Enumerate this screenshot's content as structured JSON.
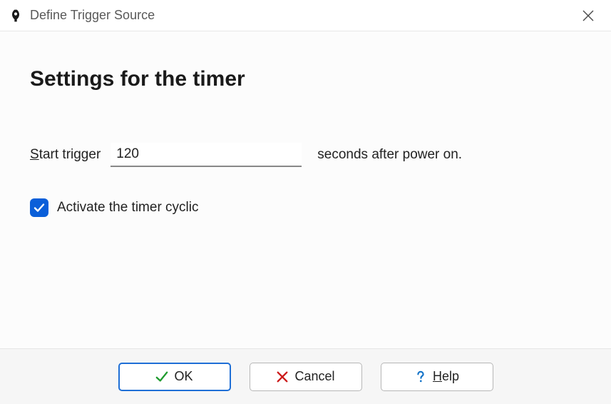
{
  "titlebar": {
    "title": "Define Trigger Source"
  },
  "content": {
    "heading": "Settings for the timer",
    "start_label_underline_letter": "S",
    "start_label_rest": "tart trigger",
    "seconds_value": "120",
    "after_label": "seconds after power on.",
    "checkbox_checked": true,
    "checkbox_label": "Activate the timer cyclic"
  },
  "footer": {
    "ok_label": "OK",
    "cancel_label": "Cancel",
    "help_underline_letter": "H",
    "help_rest": "elp"
  },
  "colors": {
    "accent": "#0a5fd9",
    "ok_check": "#1f9b2e",
    "cancel_x": "#cc1b1b",
    "help_q": "#1473c8"
  }
}
